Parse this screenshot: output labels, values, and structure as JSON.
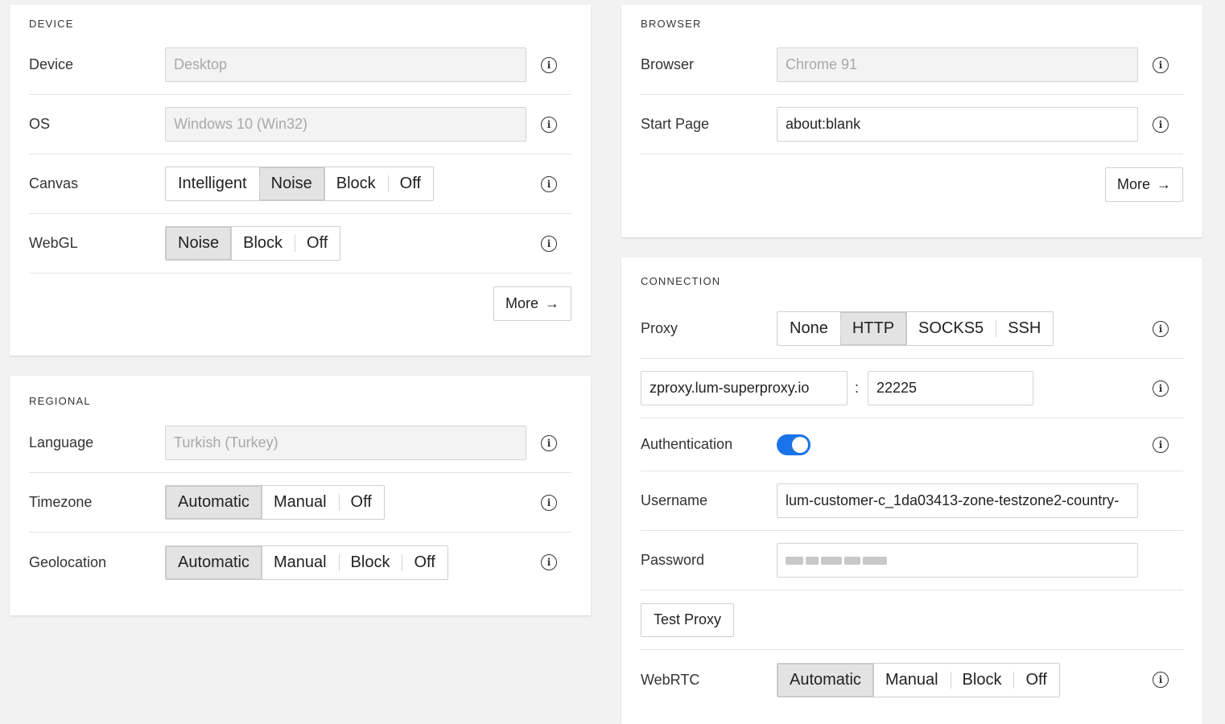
{
  "device": {
    "title": "DEVICE",
    "device": {
      "label": "Device",
      "value": "Desktop"
    },
    "os": {
      "label": "OS",
      "value": "Windows 10 (Win32)"
    },
    "canvas": {
      "label": "Canvas",
      "options": [
        "Intelligent",
        "Noise",
        "Block",
        "Off"
      ],
      "selected": "Noise"
    },
    "webgl": {
      "label": "WebGL",
      "options": [
        "Noise",
        "Block",
        "Off"
      ],
      "selected": "Noise"
    },
    "more_label": "More"
  },
  "regional": {
    "title": "REGIONAL",
    "language": {
      "label": "Language",
      "value": "Turkish (Turkey)"
    },
    "timezone": {
      "label": "Timezone",
      "options": [
        "Automatic",
        "Manual",
        "Off"
      ],
      "selected": "Automatic"
    },
    "geolocation": {
      "label": "Geolocation",
      "options": [
        "Automatic",
        "Manual",
        "Block",
        "Off"
      ],
      "selected": "Automatic"
    }
  },
  "browser": {
    "title": "BROWSER",
    "browser": {
      "label": "Browser",
      "value": "Chrome 91"
    },
    "start_page": {
      "label": "Start Page",
      "value": "about:blank"
    },
    "more_label": "More"
  },
  "connection": {
    "title": "CONNECTION",
    "proxy": {
      "label": "Proxy",
      "options": [
        "None",
        "HTTP",
        "SOCKS5",
        "SSH"
      ],
      "selected": "HTTP"
    },
    "host": "zproxy.lum-superproxy.io",
    "separator": ":",
    "port": "22225",
    "authentication": {
      "label": "Authentication",
      "enabled": true
    },
    "username": {
      "label": "Username",
      "value": "lum-customer-c_1da03413-zone-testzone2-country-"
    },
    "password": {
      "label": "Password"
    },
    "test_proxy_label": "Test Proxy",
    "webrtc": {
      "label": "WebRTC",
      "options": [
        "Automatic",
        "Manual",
        "Block",
        "Off"
      ],
      "selected": "Automatic"
    }
  },
  "colors": {
    "accent": "#1a73e8",
    "background": "#f2f2f2",
    "selected_segment": "#e3e3e3"
  }
}
